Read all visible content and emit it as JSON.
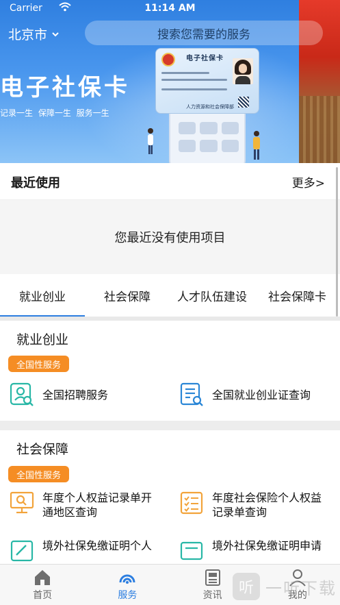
{
  "status_bar": {
    "carrier": "Carrier",
    "time": "11:14 AM"
  },
  "header": {
    "city": "北京市",
    "search_placeholder": "搜索您需要的服务"
  },
  "banner": {
    "title": "电子社保卡",
    "subtitle": "记录一生   保障一生   服务一生",
    "card_title": "电子社保卡",
    "card_footer": "人力资源和社会保障部"
  },
  "recent": {
    "title": "最近使用",
    "more": "更多>",
    "empty_text": "您最近没有使用项目"
  },
  "tabs": [
    "就业创业",
    "社会保障",
    "人才队伍建设",
    "社会保障卡"
  ],
  "sections": [
    {
      "title": "就业创业",
      "badge": "全国性服务",
      "items": [
        {
          "label": "全国招聘服务",
          "icon": "recruit-search-icon"
        },
        {
          "label": "全国就业创业证查询",
          "icon": "document-search-icon"
        }
      ]
    },
    {
      "title": "社会保障",
      "badge": "全国性服务",
      "items": [
        {
          "label_line1": "年度个人权益记录单开",
          "label_line2": "通地区查询",
          "icon": "monitor-search-icon"
        },
        {
          "label_line1": "年度社会保险个人权益",
          "label_line2": "记录单查询",
          "icon": "checklist-icon"
        },
        {
          "label_line1": "境外社保免缴证明个人",
          "icon": "edit-document-icon"
        },
        {
          "label_line1": "境外社保免缴证明申请",
          "icon": "card-icon"
        }
      ]
    }
  ],
  "bottom_nav": [
    {
      "label": "首页",
      "icon": "home-icon",
      "active": false
    },
    {
      "label": "服务",
      "icon": "service-icon",
      "active": true
    },
    {
      "label": "资讯",
      "icon": "news-icon",
      "active": false
    },
    {
      "label": "我的",
      "icon": "profile-icon",
      "active": false
    }
  ],
  "watermark": {
    "logo": "听",
    "text": "一听下载"
  },
  "colors": {
    "accent": "#2c7ee0",
    "badge": "#f58d24",
    "icon_teal": "#28b7a6",
    "icon_blue": "#2a86d6",
    "icon_orange": "#f2a33a"
  }
}
